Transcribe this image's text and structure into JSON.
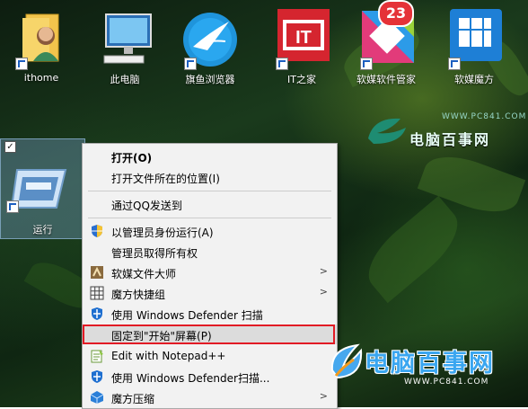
{
  "desktop": {
    "icons": [
      {
        "label": "ithome",
        "icon": "user-folder-icon"
      },
      {
        "label": "此电脑",
        "icon": "this-pc-icon"
      },
      {
        "label": "旗鱼浏览器",
        "icon": "sailfish-browser-icon"
      },
      {
        "label": "IT之家",
        "icon": "ithome-app-icon"
      },
      {
        "label": "软媒软件管家",
        "icon": "software-manager-icon",
        "badge": "23"
      },
      {
        "label": "软媒魔方",
        "icon": "ruanmei-cube-icon"
      }
    ],
    "selected_item": {
      "label": "运行",
      "icon": "run-icon"
    }
  },
  "watermark_top": {
    "url": "WWW.PC841.COM",
    "text": "电脑百事网"
  },
  "watermark_bottom": {
    "text": "电脑百事网",
    "url": "WWW.PC841.COM"
  },
  "context_menu": {
    "items": [
      {
        "label": "打开(O)",
        "bold": true
      },
      {
        "label": "打开文件所在的位置(I)"
      },
      {
        "label": "通过QQ发送到"
      },
      {
        "label": "以管理员身份运行(A)",
        "icon": "uac-shield-icon"
      },
      {
        "label": "管理员取得所有权"
      },
      {
        "label": "软媒文件大师",
        "icon": "file-master-icon",
        "submenu": true
      },
      {
        "label": "魔方快捷组",
        "icon": "grid-icon",
        "submenu": true
      },
      {
        "label": "使用 Windows Defender 扫描",
        "icon": "defender-icon"
      },
      {
        "label": "固定到\"开始\"屏幕(P)",
        "highlighted": true
      },
      {
        "label": "Edit with Notepad++",
        "icon": "notepad-plus-plus-icon"
      },
      {
        "label": "使用 Windows Defender扫描...",
        "icon": "defender-icon"
      },
      {
        "label": "魔方压缩",
        "icon": "cube-compress-icon",
        "submenu": true
      }
    ]
  },
  "colors": {
    "highlight_border": "#e21b25",
    "menu_bg": "#f2f2f2",
    "accent_blue": "#3aa6f0"
  }
}
